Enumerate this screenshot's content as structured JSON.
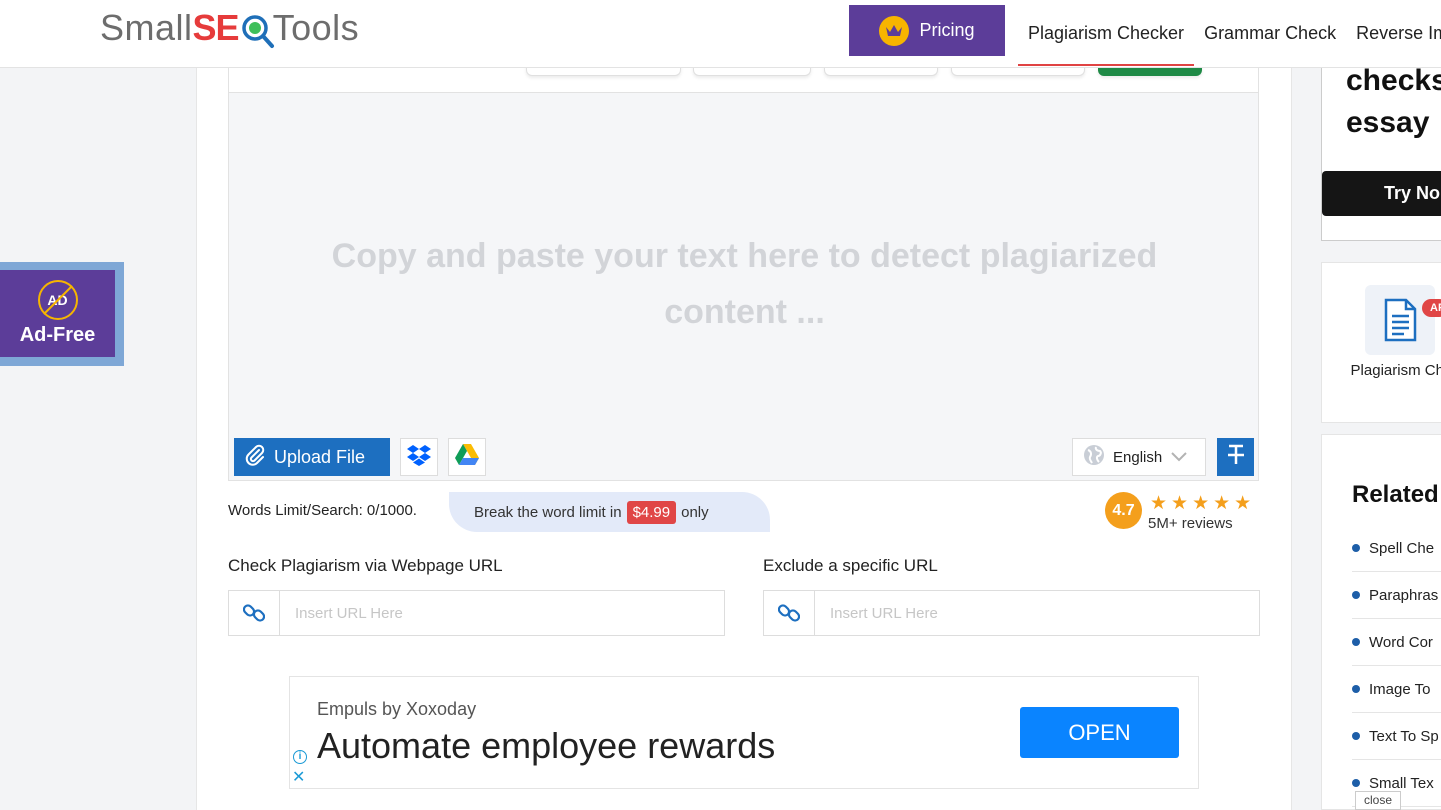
{
  "header": {
    "logo": {
      "prefix": "Small",
      "seo": "SE",
      "suffix": "Tools"
    },
    "pricing_label": "Pricing",
    "nav": [
      {
        "label": "Plagiarism Checker",
        "active": true
      },
      {
        "label": "Grammar Check",
        "active": false
      },
      {
        "label": "Reverse Ima",
        "active": false
      }
    ]
  },
  "adfree": {
    "icon_text": "AD",
    "label": "Ad-Free"
  },
  "editor": {
    "placeholder": "Copy and paste your text here to detect plagiarized content ...",
    "upload_label": "Upload File",
    "language": "English"
  },
  "limits": {
    "words_limit": "Words Limit/Search: 0/1000.",
    "break_prefix": "Break the word limit in",
    "price": "$4.99",
    "break_suffix": "only"
  },
  "rating": {
    "score": "4.7",
    "stars": "★★★★★",
    "reviews": "5M+ reviews"
  },
  "url_check": {
    "label": "Check Plagiarism via Webpage URL",
    "placeholder": "Insert URL Here"
  },
  "url_exclude": {
    "label": "Exclude a specific URL",
    "placeholder": "Insert URL Here"
  },
  "ad_banner": {
    "sponsor": "Empuls by Xoxoday",
    "headline": "Automate employee rewards",
    "cta": "OPEN",
    "info_icon": "i",
    "close_icon": "✕"
  },
  "right_ad": {
    "text": "checks\nessay",
    "button": "Try No"
  },
  "api_card": {
    "badge": "AP",
    "label": "Plagiarism Ch API"
  },
  "related": {
    "title": "Related",
    "items": [
      "Spell Che",
      "Paraphras",
      "Word Cor",
      "Image To",
      "Text To Sp",
      "Small Tex"
    ]
  },
  "close_label": "close",
  "colors": {
    "brand_purple": "#5c3d99",
    "primary_blue": "#1d6fc0",
    "accent_red": "#e04646",
    "rating_orange": "#f49f1c"
  }
}
